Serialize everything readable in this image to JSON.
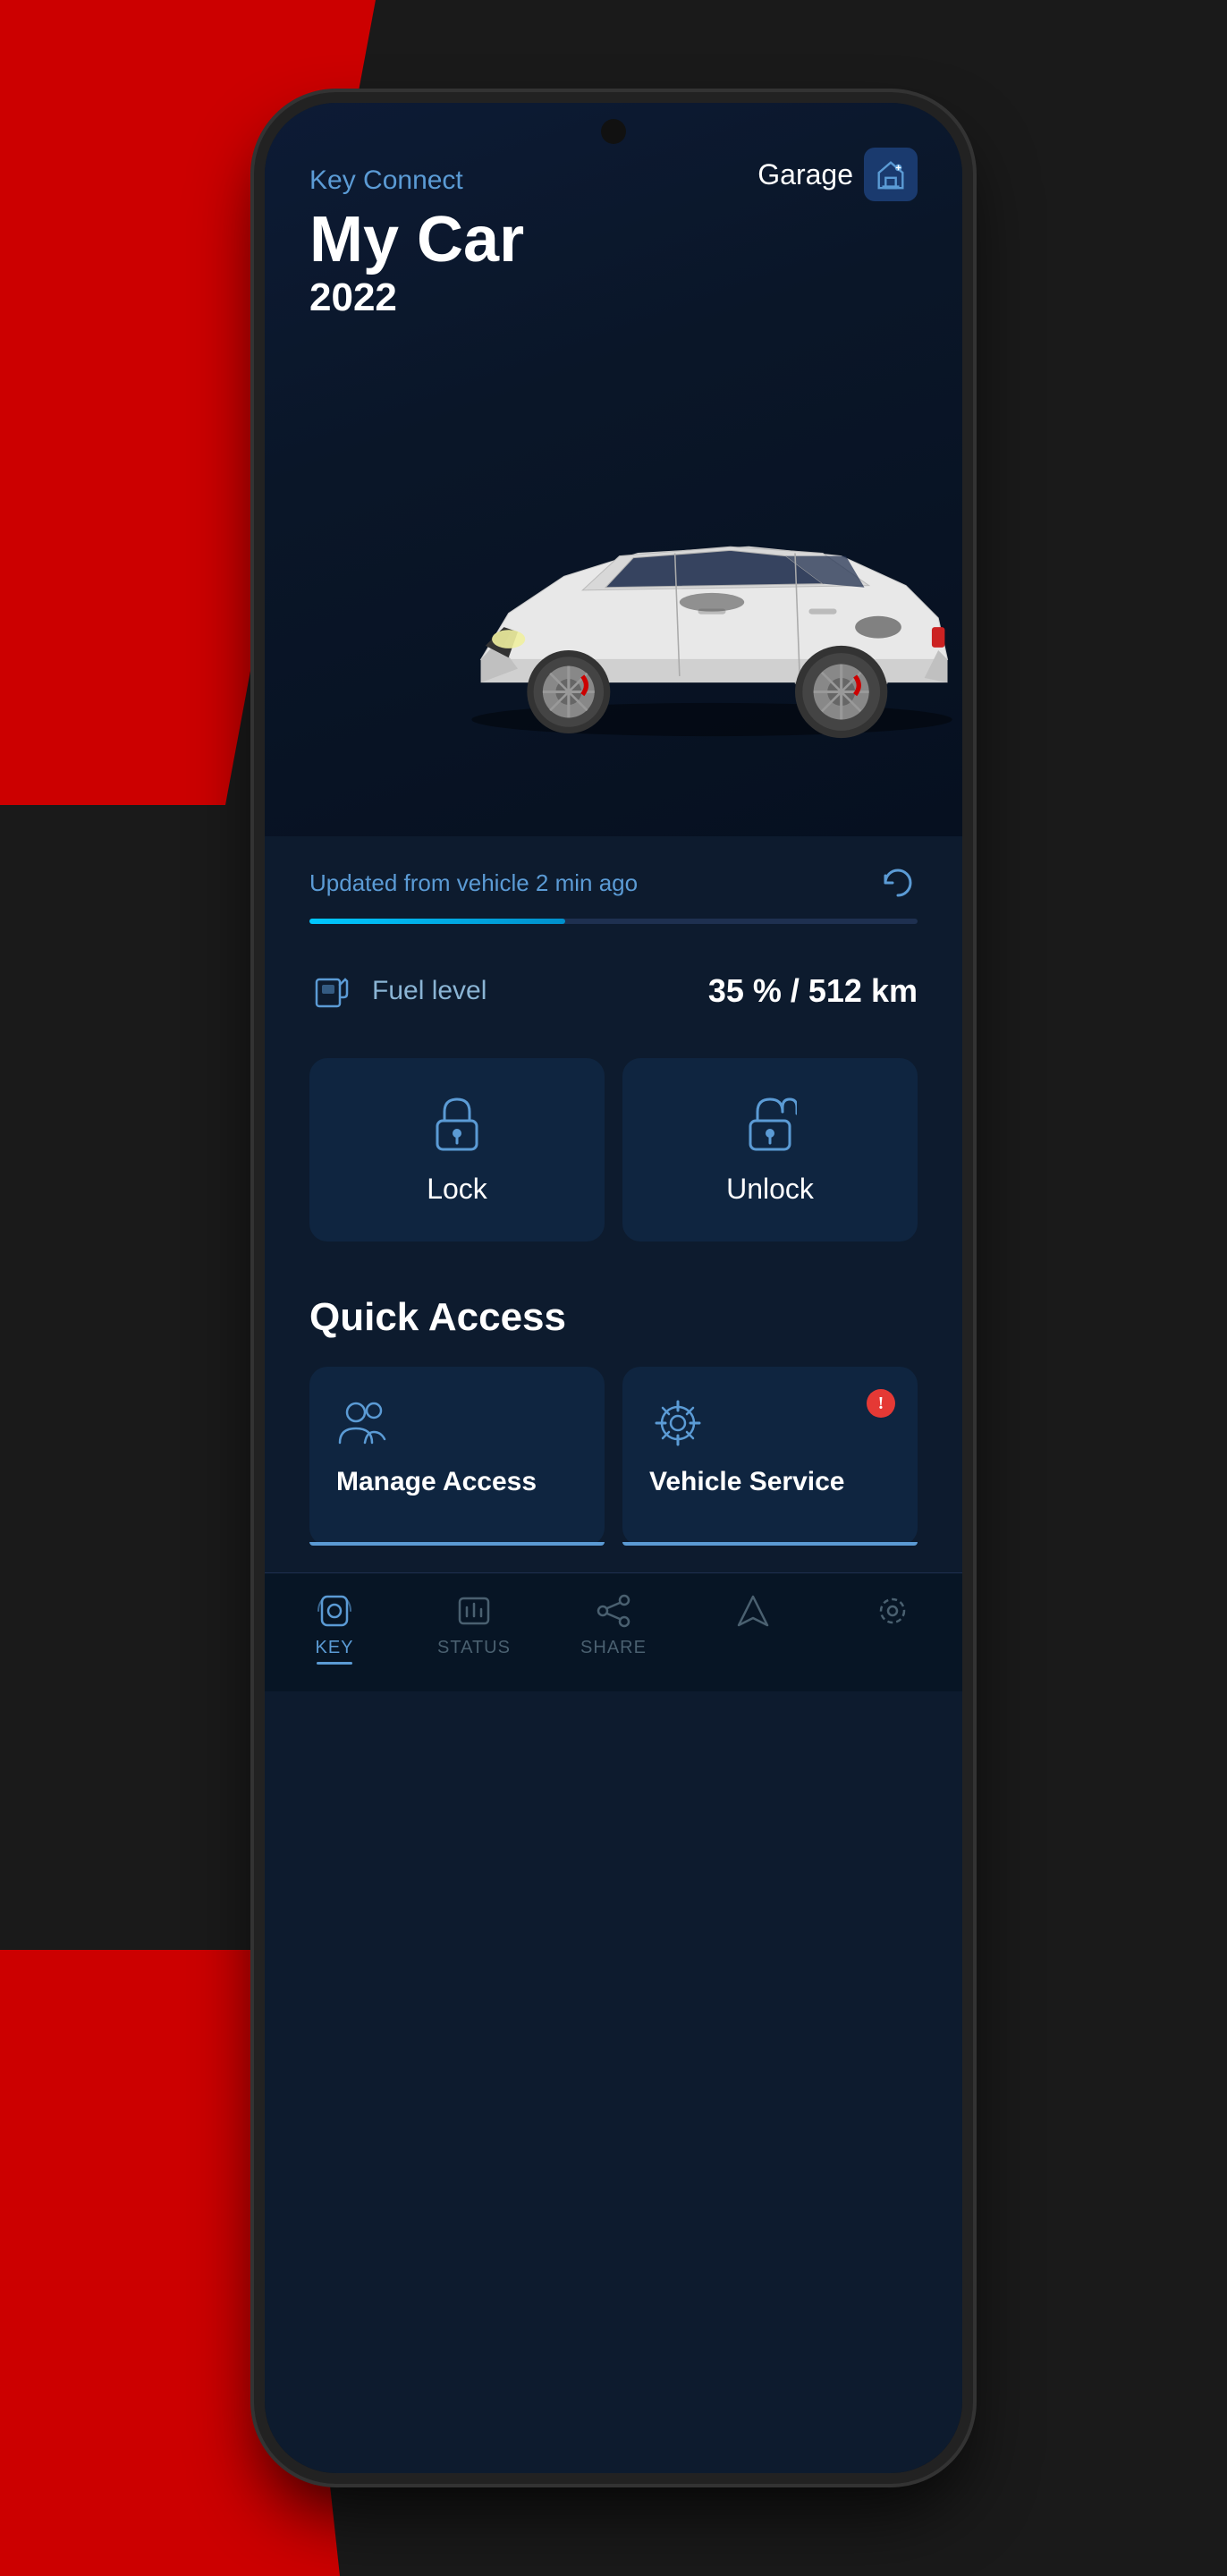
{
  "background": {
    "color": "#1a1a1a"
  },
  "header": {
    "garage_label": "Garage",
    "subtitle": "Key Connect",
    "car_name": "My Car",
    "car_year": "2022"
  },
  "status": {
    "update_text": "Updated from vehicle 2 min ago",
    "progress_percent": 42,
    "fuel_label": "Fuel level",
    "fuel_value": "35 % / 512 km"
  },
  "actions": {
    "lock_label": "Lock",
    "unlock_label": "Unlock"
  },
  "quick_access": {
    "title": "Quick Access",
    "cards": [
      {
        "id": "manage-access",
        "label": "Manage Access",
        "has_alert": false
      },
      {
        "id": "vehicle-service",
        "label": "Vehicle Service",
        "has_alert": true
      }
    ]
  },
  "bottom_nav": {
    "items": [
      {
        "id": "key",
        "label": "KEY",
        "active": true
      },
      {
        "id": "status",
        "label": "STATUS",
        "active": false
      },
      {
        "id": "share",
        "label": "SHARE",
        "active": false
      },
      {
        "id": "navigation",
        "label": "",
        "active": false
      },
      {
        "id": "settings",
        "label": "",
        "active": false
      }
    ]
  }
}
